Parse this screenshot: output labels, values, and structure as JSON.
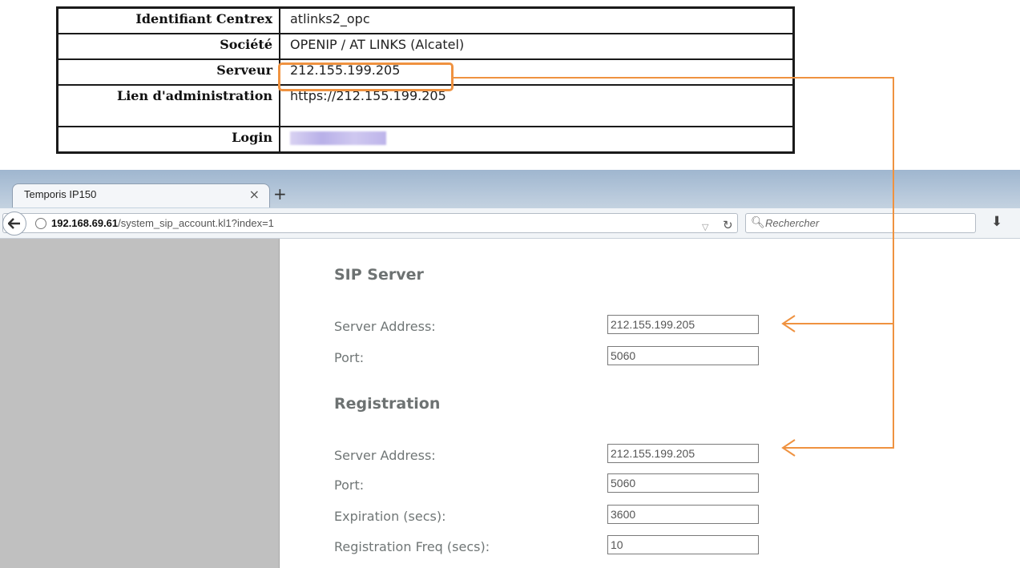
{
  "info_table": {
    "rows": [
      {
        "key": "Identifiant Centrex",
        "value": "atlinks2_opc"
      },
      {
        "key": "Société",
        "value": "OPENIP / AT LINKS (Alcatel)"
      },
      {
        "key": "Serveur",
        "value": "212.155.199.205"
      },
      {
        "key": "Lien d'administration",
        "value": "https://212.155.199.205"
      },
      {
        "key": "Login",
        "value": ""
      }
    ]
  },
  "browser": {
    "tab_title": "Temporis IP150",
    "tab_close": "×",
    "new_tab": "+",
    "url_host": "192.168.69.61",
    "url_path": "/system_sip_account.kl1?index=1",
    "search_placeholder": "Rechercher"
  },
  "sip_server": {
    "title": "SIP Server",
    "server_address_label": "Server Address:",
    "server_address_value": "212.155.199.205",
    "port_label": "Port:",
    "port_value": "5060"
  },
  "registration": {
    "title": "Registration",
    "server_address_label": "Server Address:",
    "server_address_value": "212.155.199.205",
    "port_label": "Port:",
    "port_value": "5060",
    "expiration_label": "Expiration (secs):",
    "expiration_value": "3600",
    "freq_label": "Registration Freq (secs):",
    "freq_value": "10"
  },
  "colors": {
    "annotation": "#ef9240",
    "sidebar": "#c0c0c0",
    "section_title": "#6d7272"
  }
}
